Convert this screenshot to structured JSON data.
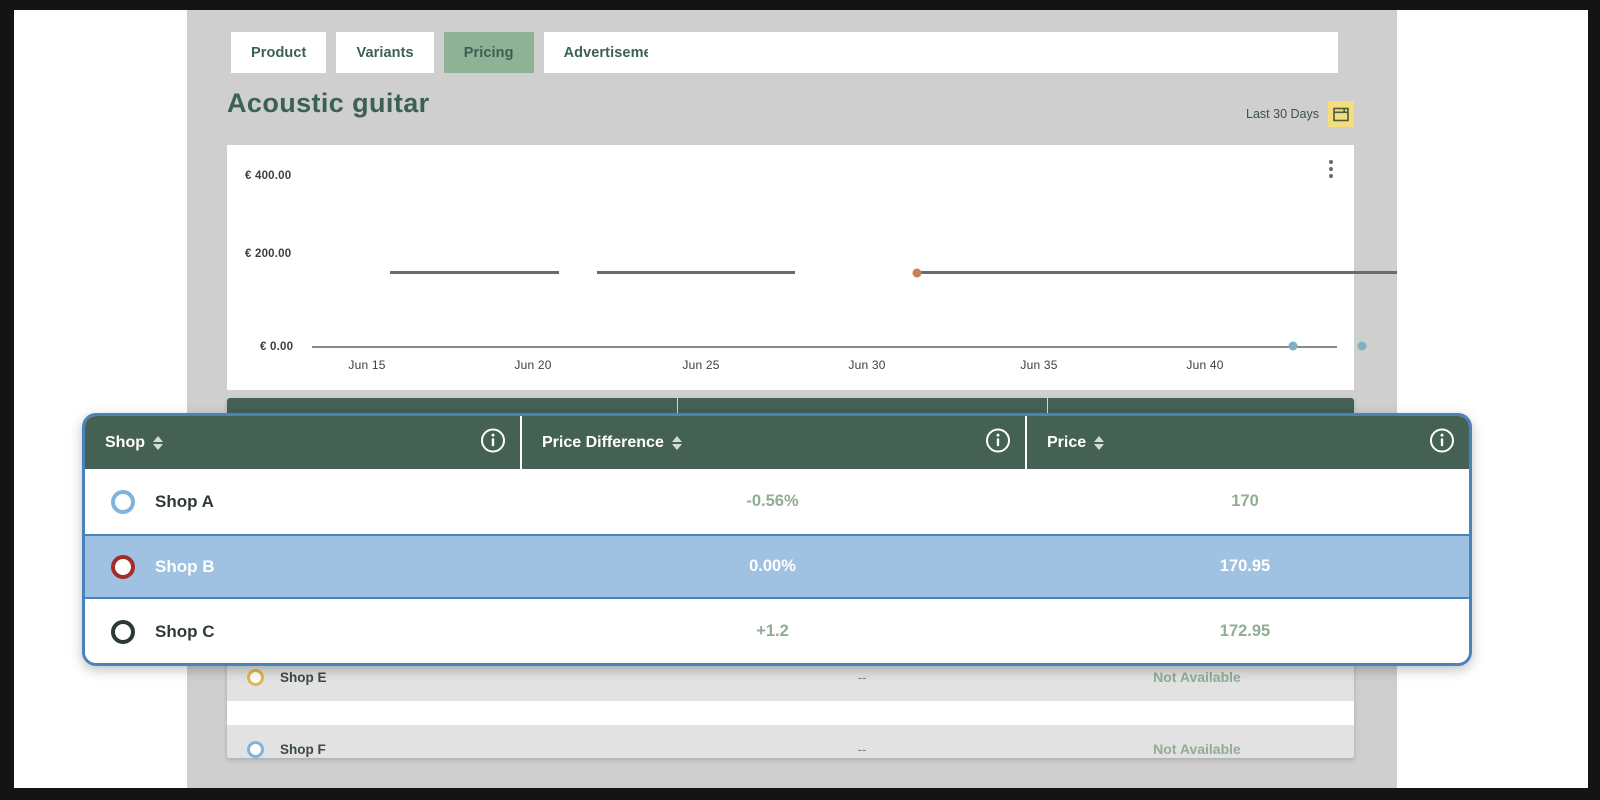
{
  "tabs": [
    {
      "label": "Product",
      "active": false
    },
    {
      "label": "Variants",
      "active": false
    },
    {
      "label": "Pricing",
      "active": true
    },
    {
      "label": "Advertisement",
      "active": false
    }
  ],
  "header": {
    "product_title": "Acoustic guitar",
    "range_label": "Last 30 Days",
    "calendar_icon": "calendar-icon",
    "search_box_value": "",
    "search_box_placeholder": ""
  },
  "chart_card": {
    "menu_icon": "kebab-menu-icon"
  },
  "chart_data": {
    "type": "line",
    "title": "",
    "xlabel": "",
    "ylabel": "",
    "ylim": [
      0,
      400
    ],
    "ytick_labels": [
      "€ 400.00",
      "€ 200.00",
      "€ 0.00"
    ],
    "ytick_values": [
      400,
      200,
      0
    ],
    "xtick_labels": [
      "Jun 15",
      "Jun 20",
      "Jun 25",
      "Jun 30",
      "Jun 35",
      "Jun 40"
    ],
    "grid": false,
    "legend": "none",
    "series": [
      {
        "name": "price-line-segment-1",
        "color": "#6b6b6b",
        "x_start_pct": 7.6,
        "x_end_pct": 22.8,
        "value": 171
      },
      {
        "name": "price-line-segment-2",
        "color": "#6b6b6b",
        "x_start_pct": 26.2,
        "x_end_pct": 43.8,
        "value": 171
      },
      {
        "name": "price-line-segment-3",
        "color": "#6b6b6b",
        "x_start_pct": 55.5,
        "x_end_pct": 99.5,
        "value": 171
      }
    ],
    "points": [
      {
        "name": "orange-marker",
        "color": "#c58158",
        "x_pct": 55.5,
        "value": 171
      },
      {
        "name": "teal-marker-1",
        "color": "#7fb0bd",
        "x_pct": 90.0,
        "value": 0
      },
      {
        "name": "teal-marker-2",
        "color": "#7fb0bd",
        "x_pct": 96.0,
        "value": 0
      }
    ],
    "axis_line_value": 0
  },
  "overlay_table": {
    "columns": [
      {
        "label": "Shop",
        "sortable": true,
        "info": true
      },
      {
        "label": "Price Difference",
        "sortable": true,
        "info": true
      },
      {
        "label": "Price",
        "sortable": true,
        "info": true
      }
    ],
    "rows": [
      {
        "radio_color": "#7fb4de",
        "shop": "Shop A",
        "price_difference": "-0.56%",
        "price": "170",
        "selected": false
      },
      {
        "radio_color": "#a82b2b",
        "shop": "Shop B",
        "price_difference": "0.00%",
        "price": "170.95",
        "selected": true
      },
      {
        "radio_color": "#2d3a33",
        "shop": "Shop C",
        "price_difference": "+1.2",
        "price": "172.95",
        "selected": false
      }
    ]
  },
  "background_table": {
    "rows": [
      {
        "radio_color": "#e0b94a",
        "shop": "Shop E",
        "price_difference": "--",
        "price": "Not Available"
      },
      {
        "radio_color": "#7fb4de",
        "shop": "Shop F",
        "price_difference": "--",
        "price": "Not Available"
      }
    ]
  },
  "colors": {
    "header_green": "#446154",
    "tab_active_green": "#8fb296",
    "title_green": "#3b6152",
    "selected_row_blue": "#9fc1e2",
    "overlay_border_blue": "#4a82bb",
    "calendar_yellow": "#f5dd7e",
    "muted_green_text": "#8fae94",
    "panel_gray": "#cfcfcf"
  }
}
